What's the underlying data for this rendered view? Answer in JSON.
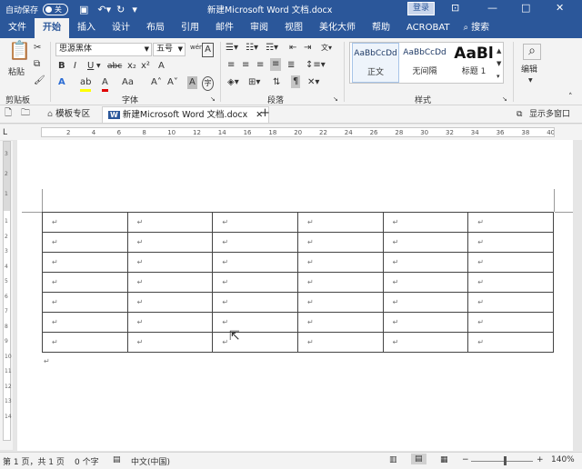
{
  "titlebar": {
    "autosave_label": "自动保存",
    "autosave_state": "关",
    "doc_title": "新建Microsoft Word 文档.docx",
    "login_label": "登录",
    "icons": [
      "save-icon",
      "undo-icon",
      "redo-icon",
      "customize-icon",
      "ribbon-display-icon",
      "minimize-icon",
      "restore-icon",
      "close-icon"
    ]
  },
  "tabs": {
    "items": [
      "文件",
      "开始",
      "插入",
      "设计",
      "布局",
      "引用",
      "邮件",
      "审阅",
      "视图",
      "美化大师",
      "帮助",
      "ACROBAT"
    ],
    "active": "开始",
    "search_label": "搜索"
  },
  "ribbon": {
    "clipboard": {
      "label": "剪贴板",
      "paste_label": "粘贴"
    },
    "font": {
      "label": "字体",
      "font_name": "思源黑体",
      "font_size": "五号",
      "wen_label": "wén",
      "bold": "B",
      "italic": "I",
      "underline": "U",
      "strike": "abc",
      "subscript": "x₂",
      "superscript": "x²",
      "text_effect": "A",
      "highlight": "ab",
      "font_color": "A",
      "case": "Aa",
      "grow": "A˄",
      "shrink": "A˅",
      "char_shade": "A",
      "enclose": "字",
      "clear": "A"
    },
    "paragraph": {
      "label": "段落"
    },
    "styles": {
      "label": "样式",
      "items": [
        {
          "preview": "AaBbCcDd",
          "name": "正文"
        },
        {
          "preview": "AaBbCcDd",
          "name": "无间隔"
        },
        {
          "preview": "AaBl",
          "name": "标题 1"
        }
      ]
    },
    "editing": {
      "label": "编辑"
    }
  },
  "docbar": {
    "tab1": "模板专区",
    "tab2": "新建Microsoft Word 文档.docx",
    "multi_window": "显示多窗口"
  },
  "ruler": {
    "h_marks": [
      "2",
      "4",
      "6",
      "8",
      "10",
      "12",
      "14",
      "16",
      "18",
      "20",
      "22",
      "24",
      "26",
      "28",
      "30",
      "32",
      "34",
      "36",
      "38",
      "40"
    ],
    "v_marks": [
      "3",
      "2",
      "1",
      "1",
      "2",
      "3",
      "4",
      "5",
      "6",
      "7",
      "8",
      "9",
      "10",
      "11",
      "12",
      "13",
      "14"
    ]
  },
  "document": {
    "rows": 7,
    "cols": 6,
    "cell_mark": "↵",
    "para_mark": "↵"
  },
  "statusbar": {
    "page": "第 1 页，共 1 页",
    "words": "0 个字",
    "lang": "中文(中国)",
    "zoom_out": "−",
    "zoom_in": "+",
    "zoom": "140%",
    "zoom_fraction": 0.55
  },
  "colors": {
    "accent": "#2b579a",
    "ribbon_bg": "#f3f3f3"
  }
}
